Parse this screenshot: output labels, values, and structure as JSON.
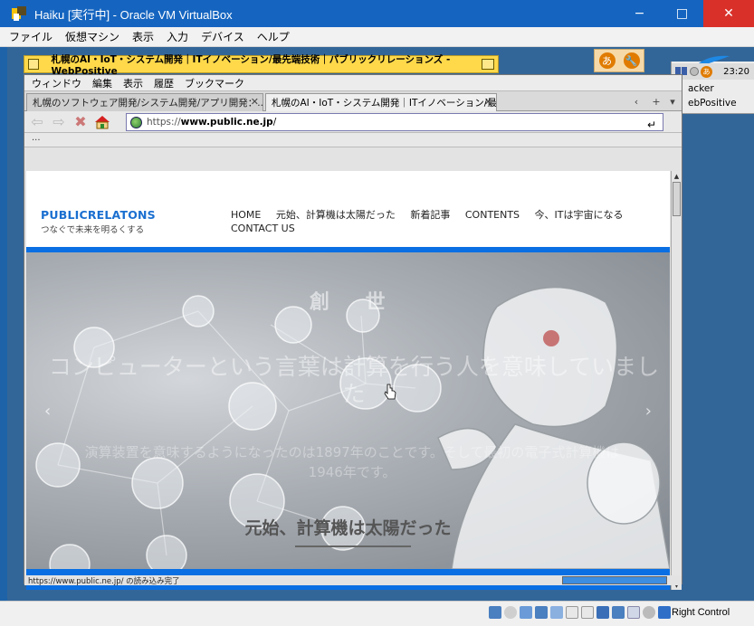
{
  "host": {
    "title": "Haiku [実行中] - Oracle VM VirtualBox",
    "menu": [
      "ファイル",
      "仮想マシン",
      "表示",
      "入力",
      "デバイス",
      "ヘルプ"
    ],
    "controls": {
      "minimize": "−",
      "maximize": "□",
      "close": "✕"
    },
    "status_hostkey": "Right Control"
  },
  "deskbar": {
    "clock": "23:20",
    "items": [
      "acker",
      "ebPositive"
    ],
    "ime_char": "あ"
  },
  "ime_palette": {
    "left": "あ",
    "right": "🔧"
  },
  "browser": {
    "window_title": "札幌のAI・IoT・システム開発｜ITイノベーション/最先端技術｜パブリックリレーションズ - WebPositive",
    "menu": [
      "ウィンドウ",
      "編集",
      "表示",
      "履歴",
      "ブックマーク"
    ],
    "tabs": [
      {
        "label": "札幌のソフトウェア開発/システム開発/アプリ開発：...",
        "active": false
      },
      {
        "label": "札幌のAI・IoT・システム開発｜ITイノベーション/最...",
        "active": true
      }
    ],
    "url_prefix": "https://",
    "url_host": "www.public.ne.jp",
    "url_suffix": "/",
    "bookmarks_text": "...",
    "status_text": "https://www.public.ne.jp/ の読み込み完了",
    "progress": 1.0
  },
  "page": {
    "logo_main": "PUBLICRELATONS",
    "logo_sub": "つなぐで未来を明るくする",
    "nav": [
      "HOME",
      "元始、計算機は太陽だった",
      "新着記事",
      "CONTENTS",
      "今、ITは宇宙になる",
      "CONTACT US"
    ],
    "hero_kanji": "創 世",
    "hero_big": "コンピューターという言葉は計算を行う人を意味していました",
    "hero_sub": "演算装置を意味するようになったのは1897年のことです。そして最初の電子式計算機は1946年です。",
    "hero_headline": "元始、計算機は太陽だった",
    "prev": "‹",
    "next": "›"
  }
}
